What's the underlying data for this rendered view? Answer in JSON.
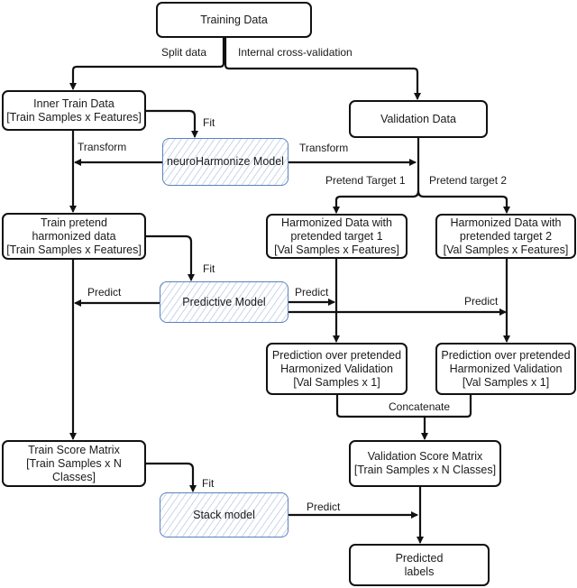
{
  "nodes": {
    "training_data": "Training Data",
    "inner_train_data": "Inner Train Data\n[Train Samples x Features]",
    "neuroharmonize_model": "neuroHarmonize Model",
    "validation_data": "Validation Data",
    "train_pretend_harmonized": "Train pretend\nharmonized data\n[Train Samples x Features]",
    "harmonized_target_1": "Harmonized Data with\npretended target 1\n[Val Samples x Features]",
    "harmonized_target_2": "Harmonized Data with\npretended target 2\n[Val Samples x Features]",
    "predictive_model": "Predictive Model",
    "prediction_1": "Prediction over pretended\nHarmonized Validation\n[Val Samples x 1]",
    "prediction_2": "Prediction over pretended\nHarmonized Validation\n[Val Samples x 1]",
    "train_score_matrix": "Train Score Matrix\n[Train Samples x N Classes]",
    "validation_score_matrix": "Validation Score Matrix\n[Train Samples x N Classes]",
    "stack_model": "Stack model",
    "predicted_labels": "Predicted\nlabels"
  },
  "edge_labels": {
    "split_data": "Split data",
    "internal_cv": "Internal cross-validation",
    "fit_harmonize": "Fit",
    "transform_train": "Transform",
    "transform_val": "Transform",
    "pretend_target_1": "Pretend Target 1",
    "pretend_target_2": "Pretend target 2",
    "fit_predictive": "Fit",
    "predict_train": "Predict",
    "predict_val_1": "Predict",
    "predict_val_2": "Predict",
    "concatenate": "Concatenate",
    "fit_stack": "Fit",
    "predict_stack": "Predict"
  },
  "colors": {
    "model_border": "#5b82c0",
    "model_hatch": "#c9d6ea",
    "line": "#111111"
  }
}
